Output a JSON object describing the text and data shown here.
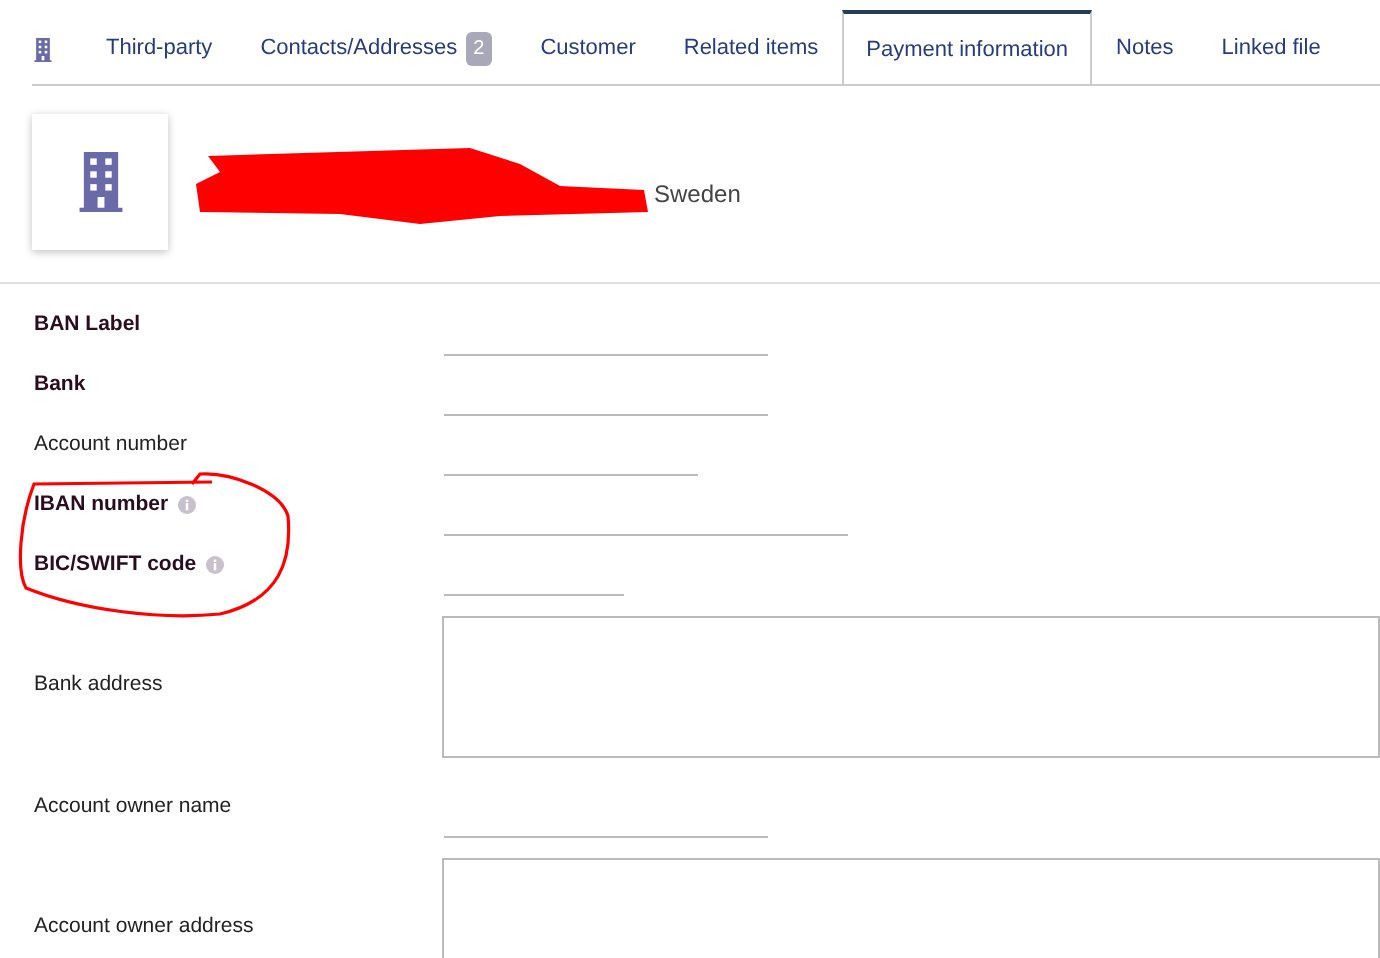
{
  "tabs": [
    {
      "kind": "icon",
      "selected": false
    },
    {
      "kind": "text",
      "label": "Third-party",
      "selected": false
    },
    {
      "kind": "text",
      "label": "Contacts/Addresses",
      "badge": "2",
      "selected": false
    },
    {
      "kind": "text",
      "label": "Customer",
      "selected": false
    },
    {
      "kind": "text",
      "label": "Related items",
      "selected": false
    },
    {
      "kind": "text",
      "label": "Payment information",
      "selected": true
    },
    {
      "kind": "text",
      "label": "Notes",
      "selected": false
    },
    {
      "kind": "text",
      "label": "Linked file",
      "selected": false
    }
  ],
  "header": {
    "country": "Sweden"
  },
  "fields": [
    {
      "label": "BAN Label",
      "required": true,
      "info": false,
      "kind": "input"
    },
    {
      "label": "Bank",
      "required": true,
      "info": false,
      "kind": "input"
    },
    {
      "label": "Account number",
      "required": false,
      "info": false,
      "kind": "input"
    },
    {
      "label": "IBAN number",
      "required": true,
      "info": true,
      "kind": "input"
    },
    {
      "label": "BIC/SWIFT code",
      "required": true,
      "info": true,
      "kind": "input"
    },
    {
      "label": "Bank address",
      "required": false,
      "info": false,
      "kind": "textarea"
    },
    {
      "label": "Account owner name",
      "required": false,
      "info": false,
      "kind": "input"
    },
    {
      "label": "Account owner address",
      "required": false,
      "info": false,
      "kind": "textarea"
    }
  ]
}
